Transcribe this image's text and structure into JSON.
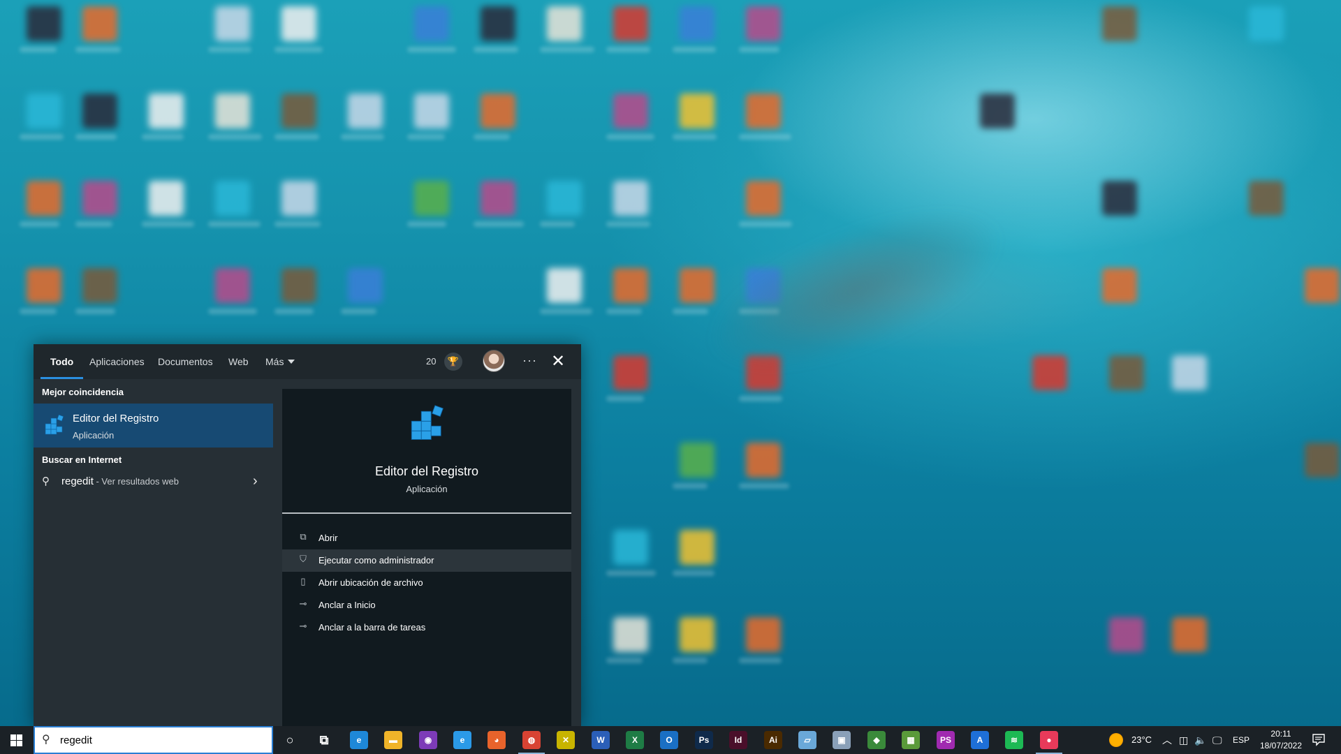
{
  "search_panel": {
    "tabs": [
      {
        "label": "Todo"
      },
      {
        "label": "Aplicaciones"
      },
      {
        "label": "Documentos"
      },
      {
        "label": "Web"
      },
      {
        "label": "Más"
      }
    ],
    "points": "20",
    "best_match_header": "Mejor coincidencia",
    "best_match": {
      "title": "Editor del Registro",
      "subtitle": "Aplicación"
    },
    "web_header": "Buscar en Internet",
    "web_result": {
      "query": "regedit",
      "suffix": " - Ver resultados web"
    },
    "preview": {
      "title": "Editor del Registro",
      "subtitle": "Aplicación",
      "actions": [
        {
          "label": "Abrir",
          "icon": "open-icon"
        },
        {
          "label": "Ejecutar como administrador",
          "icon": "shield-icon"
        },
        {
          "label": "Abrir ubicación de archivo",
          "icon": "folder-icon"
        },
        {
          "label": "Anclar a Inicio",
          "icon": "pin-icon"
        },
        {
          "label": "Anclar a la barra de tareas",
          "icon": "pin-icon"
        }
      ]
    }
  },
  "taskbar": {
    "search_value": "regedit",
    "apps": [
      {
        "name": "cortana-icon",
        "glyph": "○"
      },
      {
        "name": "task-view-icon",
        "glyph": "⧉"
      },
      {
        "name": "edge-icon",
        "glyph": "e",
        "color": "#1e88d8"
      },
      {
        "name": "file-explorer-icon",
        "glyph": "▬",
        "color": "#f0b429"
      },
      {
        "name": "tor-browser-icon",
        "glyph": "◉",
        "color": "#7d3bb8"
      },
      {
        "name": "internet-explorer-icon",
        "glyph": "e",
        "color": "#2b9ae8"
      },
      {
        "name": "firefox-icon",
        "glyph": "◕",
        "color": "#e8632b"
      },
      {
        "name": "chrome-icon",
        "glyph": "◍",
        "color": "#d84333"
      },
      {
        "name": "xmind-icon",
        "glyph": "✕",
        "color": "#c8b400"
      },
      {
        "name": "word-icon",
        "glyph": "W",
        "color": "#2b5fb8"
      },
      {
        "name": "excel-icon",
        "glyph": "X",
        "color": "#1e7c45"
      },
      {
        "name": "outlook-icon",
        "glyph": "O",
        "color": "#1a6fc4"
      },
      {
        "name": "photoshop-icon",
        "glyph": "Ps",
        "color": "#0f2a4a"
      },
      {
        "name": "indesign-icon",
        "glyph": "Id",
        "color": "#4a0f2a"
      },
      {
        "name": "illustrator-icon",
        "glyph": "Ai",
        "color": "#4a2a00"
      },
      {
        "name": "notepad-icon",
        "glyph": "▱",
        "color": "#6aa8d8"
      },
      {
        "name": "network-icon",
        "glyph": "▣",
        "color": "#8aa0b8"
      },
      {
        "name": "keepass-icon",
        "glyph": "◆",
        "color": "#3a8a3a"
      },
      {
        "name": "image-editor-icon",
        "glyph": "▦",
        "color": "#5a9a3a"
      },
      {
        "name": "phpstorm-icon",
        "glyph": "PS",
        "color": "#a02ab0"
      },
      {
        "name": "affinity-icon",
        "glyph": "A",
        "color": "#1e6fd8"
      },
      {
        "name": "spotify-icon",
        "glyph": "≋",
        "color": "#1db954"
      },
      {
        "name": "screen-recorder-icon",
        "glyph": "●",
        "color": "#e83a5a"
      }
    ],
    "tray": {
      "temperature": "23°C",
      "language": "ESP",
      "time": "20:11",
      "date": "18/07/2022"
    }
  }
}
